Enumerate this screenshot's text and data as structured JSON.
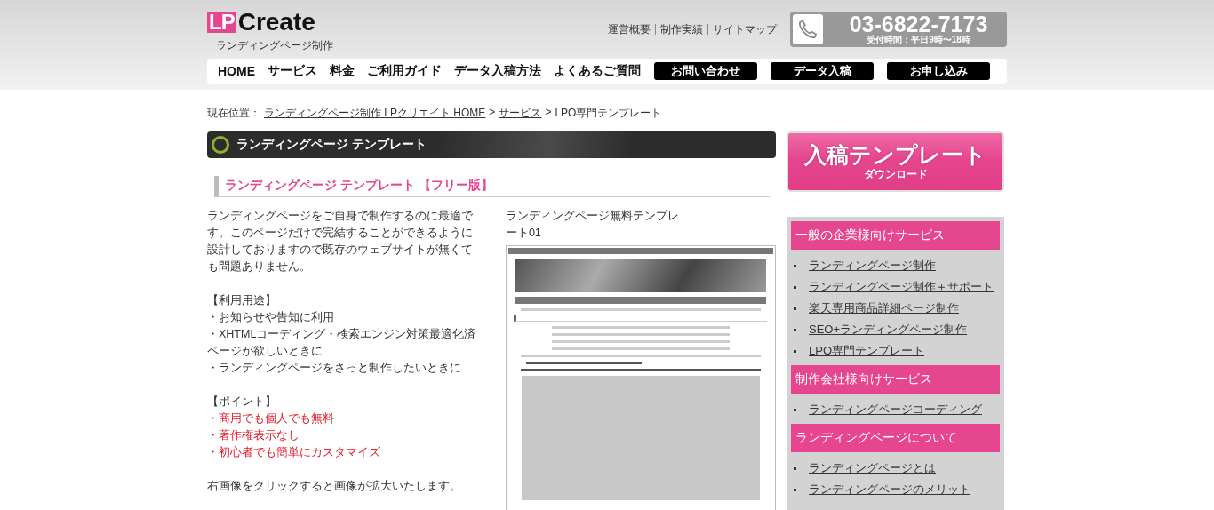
{
  "header": {
    "logo_mark": "LP",
    "logo_text": "Create",
    "tagline": "ランディングページ制作",
    "top_links": [
      "運営概要",
      "制作実績",
      "サイトマップ"
    ],
    "phone": {
      "number": "03-6822-7173",
      "hours": "受付時間：平日9時〜18時"
    }
  },
  "nav": [
    {
      "label": "HOME",
      "kind": "text"
    },
    {
      "label": "サービス",
      "kind": "text"
    },
    {
      "label": "料金",
      "kind": "text"
    },
    {
      "label": "ご利用ガイド",
      "kind": "text"
    },
    {
      "label": "データ入稿方法",
      "kind": "text"
    },
    {
      "label": "よくあるご質問",
      "kind": "text"
    },
    {
      "label": "お問い合わせ",
      "kind": "button"
    },
    {
      "label": "データ入稿",
      "kind": "button"
    },
    {
      "label": "お申し込み",
      "kind": "button"
    }
  ],
  "breadcrumb": {
    "label": "現在位置：",
    "items": [
      {
        "label": "ランディングページ制作 LPクリエイト HOME",
        "kind": "link"
      },
      {
        "label": ">",
        "kind": "separator"
      },
      {
        "label": "サービス",
        "kind": "link"
      },
      {
        "label": ">",
        "kind": "separator"
      },
      {
        "label": "LPO専門テンプレート",
        "kind": "current"
      }
    ]
  },
  "main": {
    "heading": "ランディングページ テンプレート",
    "subheading": "ランディングページ テンプレート 【フリー版】",
    "intro": "ランディングページをご自身で制作するのに最適です。このページだけで完結することができるように設計しておりますので既存のウェブサイトが無くても問題ありません。",
    "uses_title": "【利用用途】",
    "uses": [
      "・お知らせや告知に利用",
      "・XHTMLコーディング・検索エンジン対策最適化済ページが欲しいときに",
      "・ランディングページをさっと制作したいときに"
    ],
    "points_title": "【ポイント】",
    "points": [
      "・商用でも個人でも無料",
      "・著作権表示なし",
      "・初心者でも簡単にカスタマイズ"
    ],
    "note": "右画像をクリックすると画像が拡大いたします。",
    "preview_caption": "ランディングページ無料テンプレート01"
  },
  "sidebar": {
    "banner": {
      "title": "入稿テンプレート",
      "subtitle": "ダウンロード"
    },
    "sections": [
      {
        "title": "一般の企業様向けサービス",
        "links": [
          "ランディングページ制作",
          "ランディングページ制作＋サポート",
          "楽天専用商品詳細ページ制作",
          "SEO+ランディングページ制作",
          "LPO専門テンプレート"
        ]
      },
      {
        "title": "制作会社様向けサービス",
        "links": [
          "ランディングページコーディング"
        ]
      },
      {
        "title": "ランディングページについて",
        "links": [
          "ランディングページとは",
          "ランディングページのメリット"
        ]
      }
    ]
  }
}
